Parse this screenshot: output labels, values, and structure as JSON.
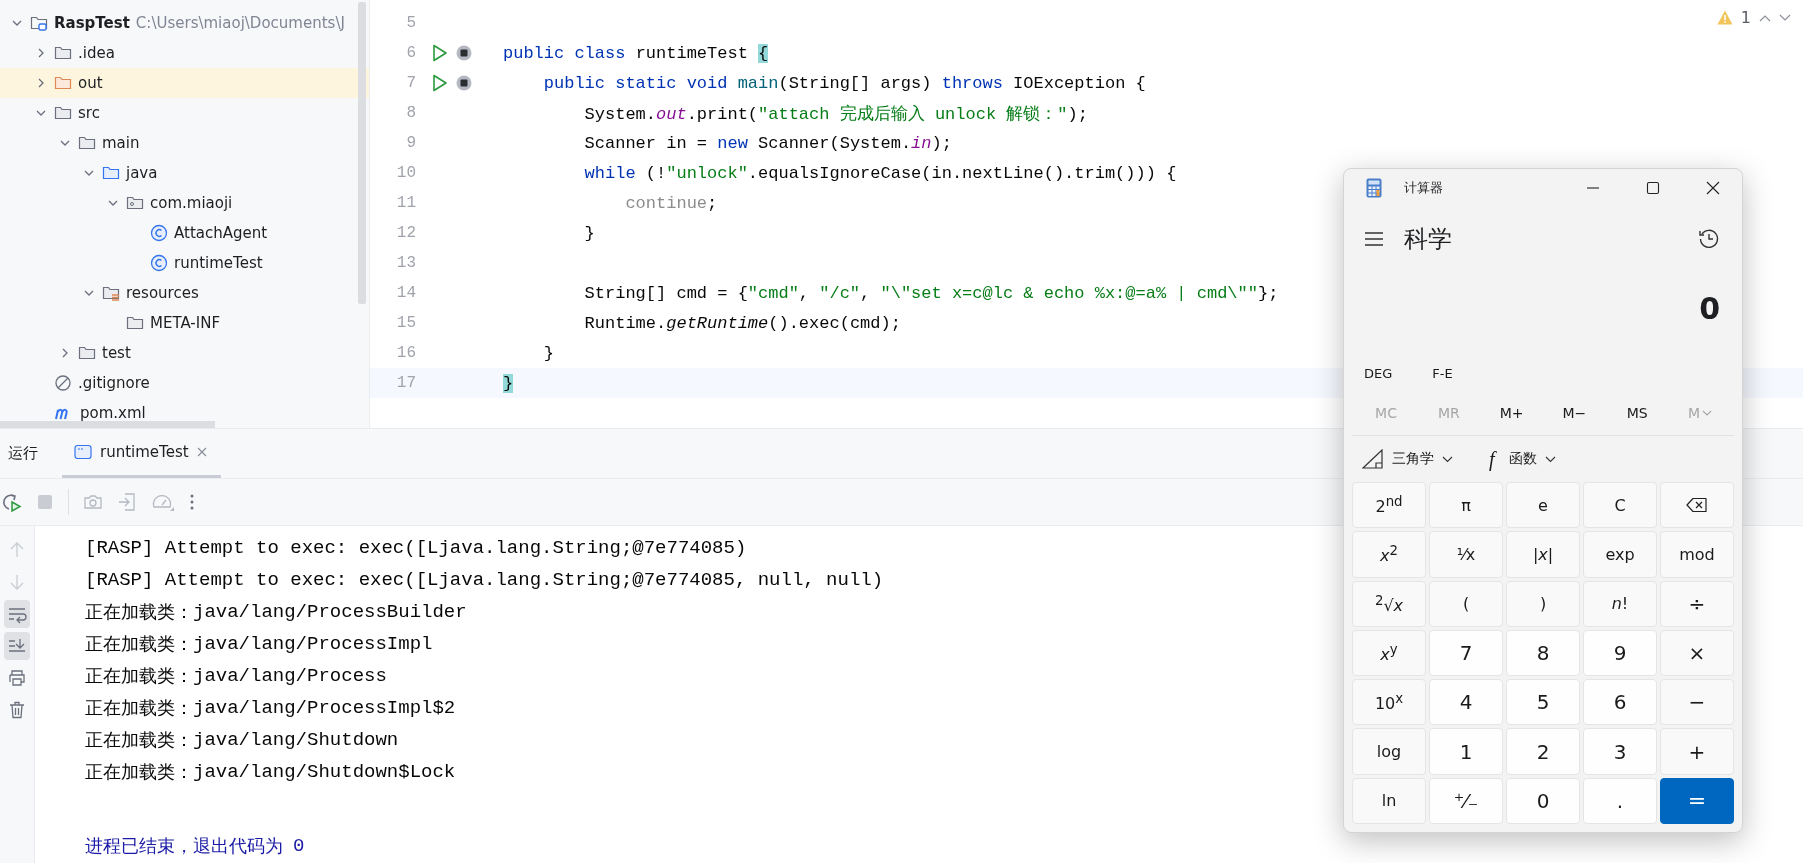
{
  "project_tree": [
    {
      "label": "RaspTest",
      "path": "C:\\Users\\miaoj\\Documents\\J",
      "kind": "module",
      "expanded": true,
      "children": [
        {
          "label": ".idea",
          "kind": "folder",
          "expanded": false
        },
        {
          "label": "out",
          "kind": "excluded",
          "expanded": false
        },
        {
          "label": "src",
          "kind": "folder",
          "expanded": true,
          "children": [
            {
              "label": "main",
              "kind": "folder",
              "expanded": true,
              "children": [
                {
                  "label": "java",
                  "kind": "source",
                  "expanded": true,
                  "children": [
                    {
                      "label": "com.miaoji",
                      "kind": "package",
                      "expanded": true,
                      "children": [
                        {
                          "label": "AttachAgent",
                          "kind": "class"
                        },
                        {
                          "label": "runtimeTest",
                          "kind": "class"
                        }
                      ]
                    }
                  ]
                },
                {
                  "label": "resources",
                  "kind": "resources",
                  "expanded": true,
                  "children": [
                    {
                      "label": "META-INF",
                      "kind": "folder"
                    }
                  ]
                }
              ]
            },
            {
              "label": "test",
              "kind": "folder",
              "expanded": false
            }
          ]
        },
        {
          "label": ".gitignore",
          "kind": "gitignore"
        },
        {
          "label": "pom.xml",
          "kind": "maven"
        }
      ]
    }
  ],
  "editor": {
    "warnings": "1",
    "lines": [
      {
        "number": "5",
        "runnable": false,
        "current": false
      },
      {
        "number": "6",
        "runnable": true,
        "current": false,
        "tokens": [
          {
            "kind": "keyword",
            "text": "public class "
          },
          {
            "kind": "plain",
            "text": "runtimeTest "
          },
          {
            "kind": "brace-match",
            "text": "{"
          }
        ]
      },
      {
        "number": "7",
        "runnable": true,
        "current": false,
        "tokens": [
          {
            "kind": "keyword",
            "text": "    public static void "
          },
          {
            "kind": "declaration",
            "text": "main"
          },
          {
            "kind": "plain",
            "text": "(String[] args) "
          },
          {
            "kind": "keyword",
            "text": "throws "
          },
          {
            "kind": "plain",
            "text": "IOException {"
          }
        ]
      },
      {
        "number": "8",
        "runnable": false,
        "current": false,
        "tokens": [
          {
            "kind": "plain",
            "text": "        System."
          },
          {
            "kind": "field",
            "text": "out"
          },
          {
            "kind": "plain",
            "text": ".print("
          },
          {
            "kind": "string",
            "text": "\"attach 完成后输入 unlock 解锁：\""
          },
          {
            "kind": "plain",
            "text": ");"
          }
        ]
      },
      {
        "number": "9",
        "runnable": false,
        "current": false,
        "tokens": [
          {
            "kind": "plain",
            "text": "        Scanner in = "
          },
          {
            "kind": "keyword",
            "text": "new "
          },
          {
            "kind": "plain",
            "text": "Scanner(System."
          },
          {
            "kind": "field",
            "text": "in"
          },
          {
            "kind": "plain",
            "text": ");"
          }
        ]
      },
      {
        "number": "10",
        "runnable": false,
        "current": false,
        "tokens": [
          {
            "kind": "keyword",
            "text": "        while "
          },
          {
            "kind": "plain",
            "text": "(!"
          },
          {
            "kind": "string",
            "text": "\"unlock\""
          },
          {
            "kind": "plain",
            "text": ".equalsIgnoreCase(in.nextLine().trim())) {"
          }
        ]
      },
      {
        "number": "11",
        "runnable": false,
        "current": false,
        "tokens": [
          {
            "kind": "dim",
            "text": "            continue"
          },
          {
            "kind": "plain",
            "text": ";"
          }
        ]
      },
      {
        "number": "12",
        "runnable": false,
        "current": false,
        "tokens": [
          {
            "kind": "plain",
            "text": "        }"
          }
        ]
      },
      {
        "number": "13",
        "runnable": false,
        "current": false
      },
      {
        "number": "14",
        "runnable": false,
        "current": false,
        "tokens": [
          {
            "kind": "plain",
            "text": "        String[] cmd = {"
          },
          {
            "kind": "string",
            "text": "\"cmd\""
          },
          {
            "kind": "plain",
            "text": ", "
          },
          {
            "kind": "string",
            "text": "\"/c\""
          },
          {
            "kind": "plain",
            "text": ", "
          },
          {
            "kind": "string",
            "text": "\"\\\"set x=c@lc & echo %x:@=a% | cmd\\\"\""
          },
          {
            "kind": "plain",
            "text": "};"
          }
        ]
      },
      {
        "number": "15",
        "runnable": false,
        "current": false,
        "tokens": [
          {
            "kind": "plain",
            "text": "        Runtime."
          },
          {
            "kind": "static",
            "text": "getRuntime"
          },
          {
            "kind": "plain",
            "text": "().exec(cmd);"
          }
        ]
      },
      {
        "number": "16",
        "runnable": false,
        "current": false,
        "tokens": [
          {
            "kind": "plain",
            "text": "    }"
          }
        ]
      },
      {
        "number": "17",
        "runnable": false,
        "current": true,
        "tokens": [
          {
            "kind": "brace-match",
            "text": "}"
          }
        ]
      }
    ]
  },
  "run_panel": {
    "title": "运行",
    "tabs": [
      {
        "label": "runtimeTest",
        "selected": true
      }
    ],
    "toolbar": [
      {
        "kind": "rerun",
        "disabled": false
      },
      {
        "kind": "stop",
        "disabled": true
      },
      {
        "kind": "screenshot",
        "disabled": true
      },
      {
        "kind": "attach",
        "disabled": true
      },
      {
        "kind": "profiler",
        "disabled": true
      },
      {
        "kind": "more",
        "disabled": false
      }
    ],
    "side_tools": [
      {
        "kind": "up",
        "disabled": true,
        "selected": false
      },
      {
        "kind": "down",
        "disabled": true,
        "selected": false
      },
      {
        "kind": "wrap",
        "disabled": false,
        "selected": true
      },
      {
        "kind": "scroll-end",
        "disabled": false,
        "selected": true
      },
      {
        "kind": "print",
        "disabled": false,
        "selected": false
      },
      {
        "kind": "trash",
        "disabled": false,
        "selected": false
      }
    ],
    "console": [
      {
        "kind": "out",
        "text": "[RASP] Attempt to exec: exec([Ljava.lang.String;@7e774085)"
      },
      {
        "kind": "out",
        "text": "[RASP] Attempt to exec: exec([Ljava.lang.String;@7e774085, null, null)"
      },
      {
        "kind": "load",
        "prefix": "正在加载类：",
        "text": "java/lang/ProcessBuilder"
      },
      {
        "kind": "load",
        "prefix": "正在加载类：",
        "text": "java/lang/ProcessImpl"
      },
      {
        "kind": "load",
        "prefix": "正在加载类：",
        "text": "java/lang/Process"
      },
      {
        "kind": "load",
        "prefix": "正在加载类：",
        "text": "java/lang/ProcessImpl$2"
      },
      {
        "kind": "load",
        "prefix": "正在加载类：",
        "text": "java/lang/Shutdown"
      },
      {
        "kind": "load",
        "prefix": "正在加载类：",
        "text": "java/lang/Shutdown$Lock"
      },
      {
        "kind": "blank"
      },
      {
        "kind": "exit",
        "prefix": "进程已结束，退出代码为",
        "text": "0"
      }
    ]
  },
  "calculator": {
    "title": "计算器",
    "mode": "科学",
    "display": "0",
    "angle": "DEG",
    "notation": "F-E",
    "memory": [
      {
        "label": "MC",
        "disabled": true,
        "dropdown": false
      },
      {
        "label": "MR",
        "disabled": true,
        "dropdown": false
      },
      {
        "label": "M+",
        "disabled": false,
        "dropdown": false
      },
      {
        "label": "M−",
        "disabled": false,
        "dropdown": false
      },
      {
        "label": "MS",
        "disabled": false,
        "dropdown": false
      },
      {
        "label": "M",
        "disabled": true,
        "dropdown": true
      }
    ],
    "menus": [
      {
        "kind": "trig",
        "label": "三角学"
      },
      {
        "kind": "function",
        "icon": "f",
        "label": "函数"
      }
    ],
    "keys": [
      {
        "kind": "fn",
        "label": "2$^{nd}$"
      },
      {
        "kind": "fn",
        "label": "π"
      },
      {
        "kind": "fn",
        "label": "e"
      },
      {
        "kind": "fn",
        "label": "C"
      },
      {
        "kind": "backspace"
      },
      {
        "kind": "fn",
        "label": "*x*$^{2}$"
      },
      {
        "kind": "fn",
        "label": "⅟x"
      },
      {
        "kind": "fn",
        "label": "|*x*|"
      },
      {
        "kind": "fn",
        "label": "exp"
      },
      {
        "kind": "fn",
        "label": "mod"
      },
      {
        "kind": "fn",
        "label": "$^{2}$√*x*"
      },
      {
        "kind": "fn",
        "label": "("
      },
      {
        "kind": "fn",
        "label": ")"
      },
      {
        "kind": "fn",
        "label": "*n*!"
      },
      {
        "kind": "op",
        "label": "÷"
      },
      {
        "kind": "fn",
        "label": "*x*$^{y}$"
      },
      {
        "kind": "digit",
        "label": "7"
      },
      {
        "kind": "digit",
        "label": "8"
      },
      {
        "kind": "digit",
        "label": "9"
      },
      {
        "kind": "op",
        "label": "×"
      },
      {
        "kind": "fn",
        "label": "10$^{x}$"
      },
      {
        "kind": "digit",
        "label": "4"
      },
      {
        "kind": "digit",
        "label": "5"
      },
      {
        "kind": "digit",
        "label": "6"
      },
      {
        "kind": "op",
        "label": "−"
      },
      {
        "kind": "fn",
        "label": "log"
      },
      {
        "kind": "digit",
        "label": "1"
      },
      {
        "kind": "digit",
        "label": "2"
      },
      {
        "kind": "digit",
        "label": "3"
      },
      {
        "kind": "op",
        "label": "+"
      },
      {
        "kind": "fn",
        "label": "ln"
      },
      {
        "kind": "digit",
        "label": "⁺⁄₋"
      },
      {
        "kind": "digit",
        "label": "0"
      },
      {
        "kind": "digit",
        "label": "."
      },
      {
        "kind": "equals",
        "label": "="
      }
    ]
  }
}
